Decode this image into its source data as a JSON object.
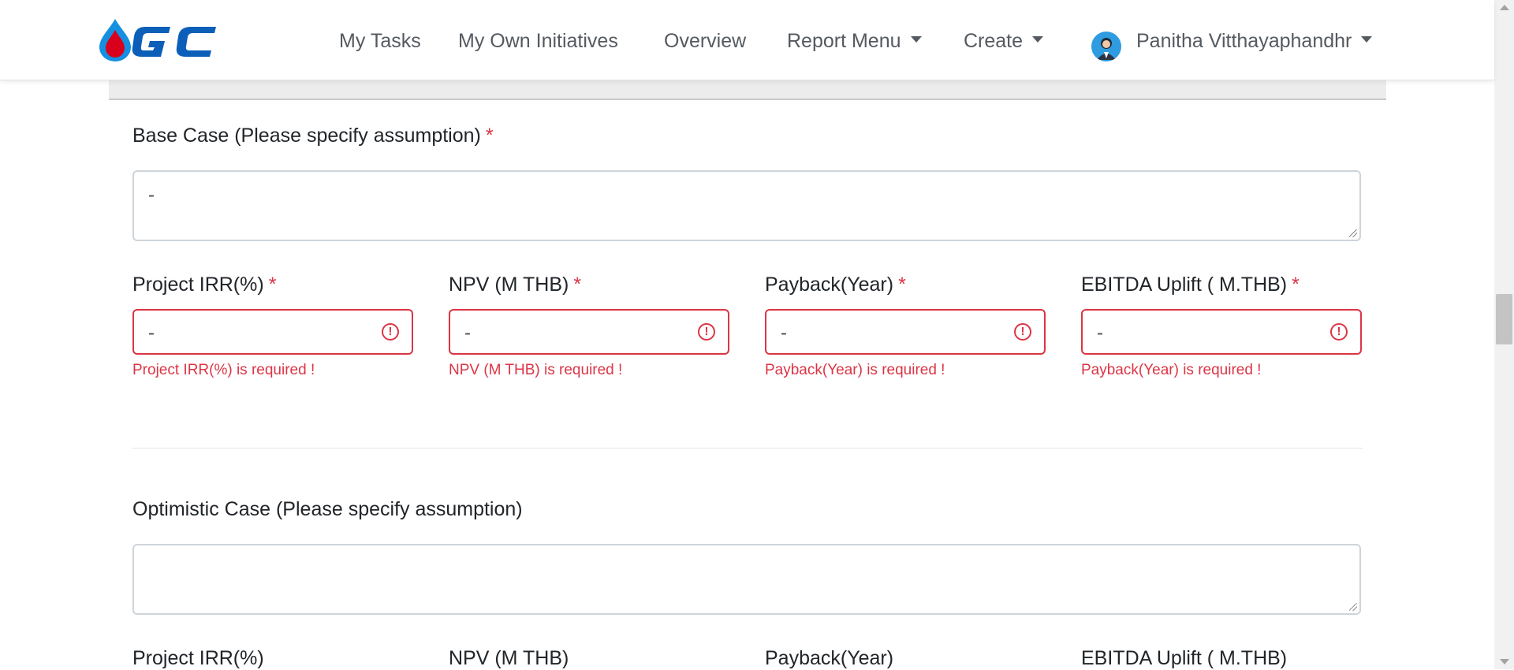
{
  "brand": {
    "logo_text": "GC",
    "colors": {
      "brand_blue": "#0c5fb8",
      "drop_red": "#d9001b",
      "drop_blue": "#1590e0"
    }
  },
  "nav": {
    "items": [
      {
        "label": "My Tasks"
      },
      {
        "label": "My Own Initiatives"
      },
      {
        "label": "Overview"
      },
      {
        "label": "Report Menu"
      },
      {
        "label": "Create"
      }
    ],
    "user_name": "Panitha Vitthayaphandhr"
  },
  "base_case": {
    "label": "Base Case (Please specify assumption)",
    "required_mark": "*",
    "value": "-",
    "fields": [
      {
        "label": "Project IRR(%)",
        "value": "-",
        "error": "Project IRR(%) is required !"
      },
      {
        "label": "NPV (M THB)",
        "value": "-",
        "error": "NPV (M THB) is required !"
      },
      {
        "label": "Payback(Year)",
        "value": "-",
        "error": "Payback(Year) is required !"
      },
      {
        "label": "EBITDA Uplift ( M.THB)",
        "value": "-",
        "error": "Payback(Year) is required !"
      }
    ]
  },
  "optimistic_case": {
    "label": "Optimistic Case (Please specify assumption)",
    "value": "",
    "fields": [
      {
        "label": "Project IRR(%)"
      },
      {
        "label": "NPV (M THB)"
      },
      {
        "label": "Payback(Year)"
      },
      {
        "label": "EBITDA Uplift ( M.THB)"
      }
    ]
  },
  "colors": {
    "error": "#dc3545",
    "nav_text": "#555a60"
  }
}
